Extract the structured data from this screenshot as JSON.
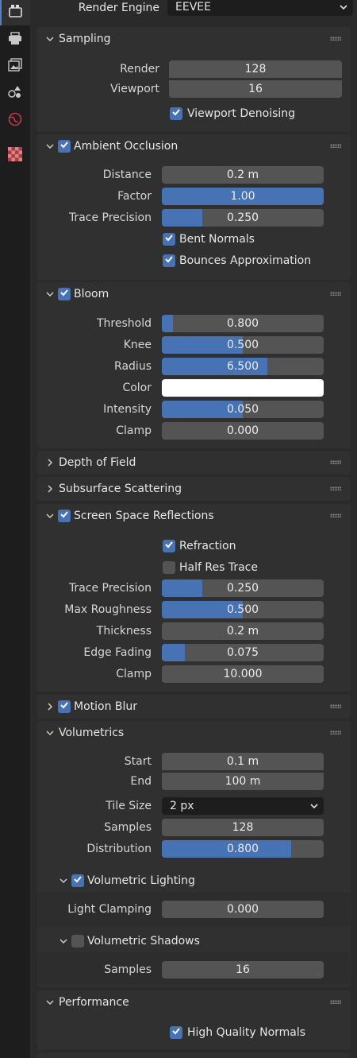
{
  "sidebar": {
    "tabs": [
      {
        "icon": "render-camera-icon",
        "active": true
      },
      {
        "icon": "printer-output-icon"
      },
      {
        "icon": "view-layer-icon"
      },
      {
        "icon": "scene-icon"
      },
      {
        "icon": "world-icon"
      },
      {
        "icon": "texture-checker-icon"
      }
    ]
  },
  "render_engine": {
    "label": "Render Engine",
    "value": "EEVEE"
  },
  "sampling": {
    "title": "Sampling",
    "render_label": "Render",
    "render_value": "128",
    "viewport_label": "Viewport",
    "viewport_value": "16",
    "viewport_denoising_label": "Viewport Denoising",
    "viewport_denoising": true
  },
  "ambient_occlusion": {
    "title": "Ambient Occlusion",
    "enabled": true,
    "distance_label": "Distance",
    "distance_value": "0.2 m",
    "factor_label": "Factor",
    "factor_value": "1.00",
    "factor_fill": 1.0,
    "trace_precision_label": "Trace Precision",
    "trace_precision_value": "0.250",
    "trace_precision_fill": 0.25,
    "bent_normals_label": "Bent Normals",
    "bent_normals": true,
    "bounces_label": "Bounces Approximation",
    "bounces": true
  },
  "bloom": {
    "title": "Bloom",
    "enabled": true,
    "threshold_label": "Threshold",
    "threshold_value": "0.800",
    "threshold_fill": 0.07,
    "knee_label": "Knee",
    "knee_value": "0.500",
    "knee_fill": 0.5,
    "radius_label": "Radius",
    "radius_value": "6.500",
    "radius_fill": 0.65,
    "color_label": "Color",
    "color_value": "#ffffff",
    "intensity_label": "Intensity",
    "intensity_value": "0.050",
    "intensity_fill": 0.5,
    "clamp_label": "Clamp",
    "clamp_value": "0.000"
  },
  "depth_of_field": {
    "title": "Depth of Field"
  },
  "subsurface_scattering": {
    "title": "Subsurface Scattering"
  },
  "ssr": {
    "title": "Screen Space Reflections",
    "enabled": true,
    "refraction_label": "Refraction",
    "refraction": true,
    "half_res_label": "Half Res Trace",
    "half_res": false,
    "trace_precision_label": "Trace Precision",
    "trace_precision_value": "0.250",
    "trace_precision_fill": 0.25,
    "max_roughness_label": "Max Roughness",
    "max_roughness_value": "0.500",
    "max_roughness_fill": 0.5,
    "thickness_label": "Thickness",
    "thickness_value": "0.2 m",
    "edge_fading_label": "Edge Fading",
    "edge_fading_value": "0.075",
    "edge_fading_fill": 0.14,
    "clamp_label": "Clamp",
    "clamp_value": "10.000"
  },
  "motion_blur": {
    "title": "Motion Blur",
    "enabled": true
  },
  "volumetrics": {
    "title": "Volumetrics",
    "start_label": "Start",
    "start_value": "0.1 m",
    "end_label": "End",
    "end_value": "100 m",
    "tile_size_label": "Tile Size",
    "tile_size_value": "2 px",
    "samples_label": "Samples",
    "samples_value": "128",
    "distribution_label": "Distribution",
    "distribution_value": "0.800",
    "distribution_fill": 0.8,
    "lighting": {
      "title": "Volumetric Lighting",
      "enabled": true,
      "clamping_label": "Light Clamping",
      "clamping_value": "0.000"
    },
    "shadows": {
      "title": "Volumetric Shadows",
      "enabled": false,
      "samples_label": "Samples",
      "samples_value": "16"
    }
  },
  "performance": {
    "title": "Performance",
    "hq_normals_label": "High Quality Normals",
    "hq_normals": true
  },
  "colors": {
    "accent": "#4772b3",
    "field": "#545454",
    "panel": "#303030"
  }
}
